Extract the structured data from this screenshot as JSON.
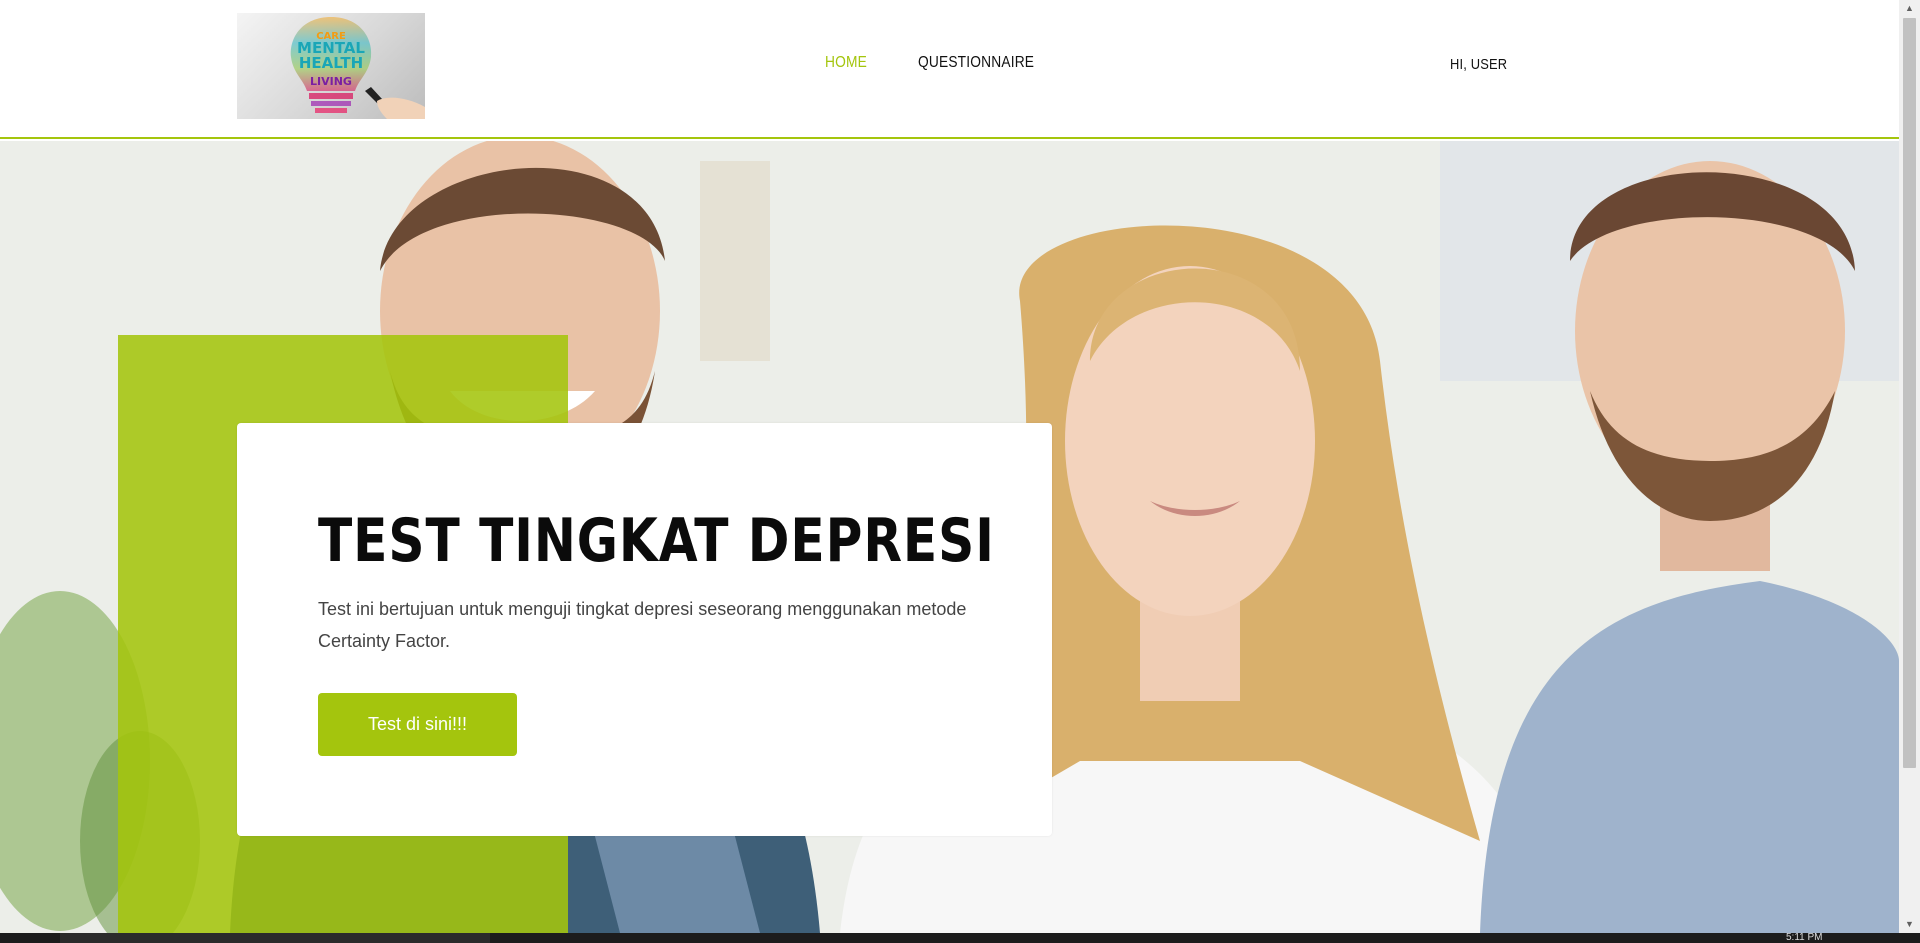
{
  "header": {
    "logo_icon": "mental-health-lightbulb-logo",
    "logo_words": [
      "CARE",
      "ACTIVE",
      "MENTAL",
      "HEALTH",
      "LIVING"
    ],
    "nav": [
      {
        "label": "HOME",
        "active": true
      },
      {
        "label": "QUESTIONNAIRE",
        "active": false
      }
    ],
    "user_greeting": "HI, USER"
  },
  "hero": {
    "title": "TEST TINGKAT DEPRESI",
    "description": "Test ini bertujuan untuk menguji tingkat depresi seseorang menggunakan metode Certainty Factor.",
    "cta_label": "Test di sini!!!"
  },
  "taskbar": {
    "clock": "5:11 PM"
  },
  "colors": {
    "accent": "#a4c50d",
    "title": "#0b0b0b",
    "text": "#444444"
  }
}
